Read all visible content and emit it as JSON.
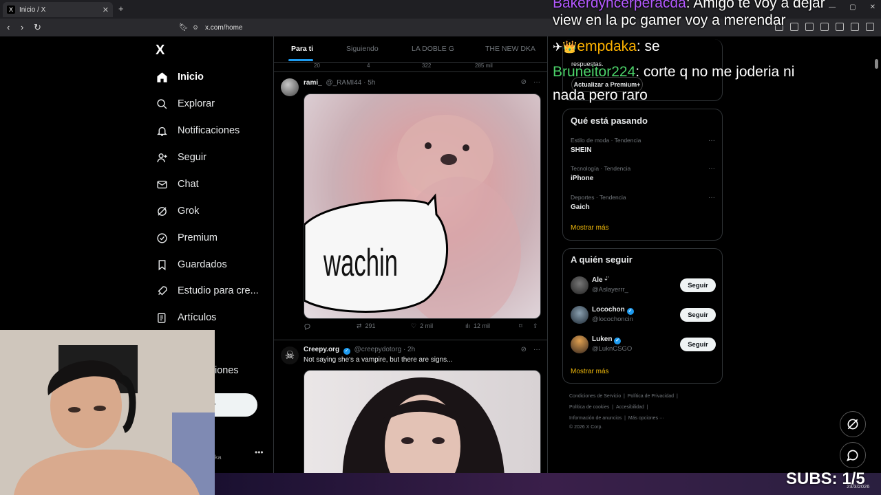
{
  "browser": {
    "tab_title": "Inicio / X",
    "tab_favicon": "X",
    "tab_close": "✕",
    "new_tab": "+",
    "url": "x.com/home",
    "window_controls": [
      "—",
      "▢",
      "✕"
    ]
  },
  "nav": {
    "logo": "X",
    "items": [
      {
        "label": "Inicio",
        "icon": "home-icon",
        "active": true
      },
      {
        "label": "Explorar",
        "icon": "search-icon"
      },
      {
        "label": "Notificaciones",
        "icon": "bell-icon"
      },
      {
        "label": "Seguir",
        "icon": "add-person-icon"
      },
      {
        "label": "Chat",
        "icon": "envelope-icon"
      },
      {
        "label": "Grok",
        "icon": "grok-icon"
      },
      {
        "label": "Premium",
        "icon": "check-badge-icon"
      },
      {
        "label": "Guardados",
        "icon": "bookmark-icon"
      },
      {
        "label": "Estudio para cre...",
        "icon": "rocket-icon"
      },
      {
        "label": "Artículos",
        "icon": "article-icon"
      }
    ],
    "partial_item": "iones",
    "post_partial": "r",
    "more": "•••",
    "account_partial": "ka"
  },
  "feed": {
    "tabs": [
      "Para ti",
      "Siguiendo",
      "LA DOBLE G",
      "THE NEW DKA"
    ],
    "prev_counts": [
      "20",
      "4",
      "322",
      "285 mil"
    ],
    "posts": [
      {
        "name": "rami_",
        "handle": "@_RAMI44",
        "time": "5h",
        "image_caption": "wachin",
        "retweets": "291",
        "likes": "2 mil",
        "views": "12 mil"
      },
      {
        "name": "Creepy.org",
        "handle": "@creepydotorg",
        "time": "2h",
        "verified": true,
        "text": "Not saying she's a vampire, but there are signs..."
      }
    ]
  },
  "premium": {
    "text": "respuestas.",
    "button": "Actualizar a Premium+"
  },
  "trends": {
    "title": "Qué está pasando",
    "items": [
      {
        "category": "Estilo de moda · Tendencia",
        "topic": "SHEIN"
      },
      {
        "category": "Tecnología · Tendencia",
        "topic": "iPhone"
      },
      {
        "category": "Deportes · Tendencia",
        "topic": "Gaich"
      }
    ],
    "more": "Mostrar más"
  },
  "who_to_follow": {
    "title": "A quién seguir",
    "items": [
      {
        "name": "Ale ᵕ̈",
        "handle": "@Aslayerrr_",
        "verified": false
      },
      {
        "name": "Locochon",
        "handle": "@locochoncin",
        "verified": true
      },
      {
        "name": "Luken",
        "handle": "@LuknCSGO",
        "verified": true
      }
    ],
    "follow_label": "Seguir",
    "more": "Mostrar más"
  },
  "footer": {
    "line1": [
      "Condiciones de Servicio",
      "|",
      "Política de Privacidad",
      "|"
    ],
    "line2": [
      "Política de cookies",
      "|",
      "Accesibilidad",
      "|"
    ],
    "line3": [
      "Información de anuncios",
      "|",
      "Más opciones ···"
    ],
    "line4": "© 2026 X Corp."
  },
  "stream_chat": [
    {
      "user": "Bakerdyhcerperacda",
      "text": ": Amigo te voy a dejar"
    },
    {
      "user": "",
      "text": "view en la pc gamer voy a merendar"
    },
    {
      "user": "empdaka",
      "text": ": se",
      "badge": "✈👑"
    },
    {
      "user": "Bruneitor224",
      "text": ": corte q no me joderia ni"
    },
    {
      "user": "",
      "text": "nada pero raro"
    }
  ],
  "overlay": {
    "subs": "SUBS: 1/5",
    "date": "23/3/2026"
  }
}
